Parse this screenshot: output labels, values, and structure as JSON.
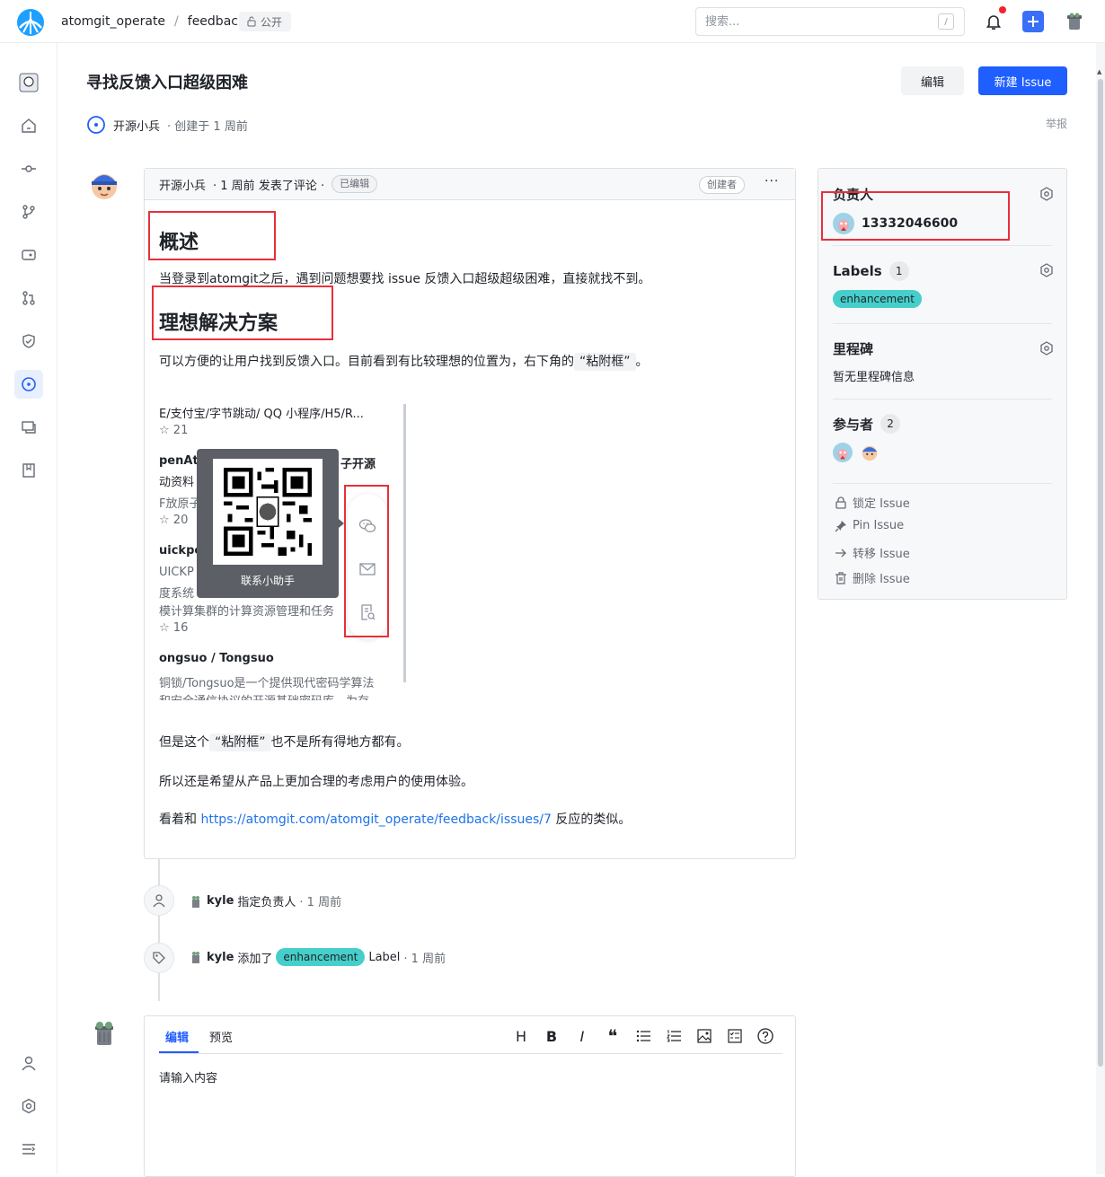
{
  "topbar": {
    "repo_owner": "atomgit_operate",
    "separator": "/",
    "repo_name": "feedback",
    "visibility": "公开",
    "search_placeholder": "搜索...",
    "search_shortcut": "/"
  },
  "issue": {
    "title": "寻找反馈入口超级困难",
    "edit_label": "编辑",
    "new_issue_label": "新建 Issue",
    "author": "开源小兵",
    "created": "· 创建于 1 周前",
    "report_label": "举报"
  },
  "comment": {
    "author": "开源小兵",
    "meta": "· 1 周前 发表了评论 ·",
    "edited": "已编辑",
    "creator": "创建者",
    "more": "···",
    "h_overview": "概述",
    "overview_text": "当登录到atomgit之后，遇到问题想要找 issue 反馈入口超级超级困难，直接就找不到。",
    "h_solution": "理想解决方案",
    "solution_text_pre": "可以方便的让用户找到反馈入口。目前看到有比较理想的位置为，右下角的",
    "solution_code": "“粘附框”",
    "solution_text_post": "。",
    "para2_pre": "但是这个",
    "para2_code": "“粘附框”",
    "para2_post": "也不是所有得地方都有。",
    "para3": "所以还是希望从产品上更加合理的考虑用户的使用体验。",
    "para4_pre": "看着和",
    "para4_link": "https://atomgit.com/atomgit_operate/feedback/issues/7",
    "para4_post": "反应的类似。"
  },
  "embedded_screenshot": {
    "line1": "E/支付宝/字节跳动/ QQ 小程序/H5/R...",
    "line2": "21",
    "line3a": "penAt",
    "line3b": "子开源",
    "line4": "动资料",
    "line5": "F放原子",
    "line6": "20",
    "line7": "uickpo",
    "line8": "UICKP",
    "line9": "度系统",
    "line10": "模计算集群的计算资源管理和任务",
    "line11": "16",
    "line12": "ongsuo / Tongsuo",
    "line13": "铜锁/Tongsuo是一个提供现代密码学算法",
    "line14": "和安全通信协议的开源基础密码库，为存",
    "qr_label": "联系小助手"
  },
  "timeline": [
    {
      "user": "kyle",
      "action": "指定负责人",
      "time": "· 1 周前"
    },
    {
      "user": "kyle",
      "action": "添加了",
      "label": "enhancement",
      "suffix": "Label",
      "time": "· 1 周前"
    }
  ],
  "editor": {
    "tab_edit": "编辑",
    "tab_preview": "预览",
    "placeholder": "请输入内容",
    "tool_heading": "H",
    "tool_bold": "B",
    "tool_italic": "I",
    "tool_quote": "❝"
  },
  "sidebar_panel": {
    "assignee_title": "负责人",
    "assignee_name": "13332046600",
    "labels_title": "Labels",
    "labels_count": "1",
    "label_name": "enhancement",
    "milestone_title": "里程碑",
    "milestone_value": "暂无里程碑信息",
    "participants_title": "参与者",
    "participants_count": "2",
    "lock": "锁定 Issue",
    "pin": "Pin Issue",
    "transfer": "转移 Issue",
    "delete": "删除 Issue"
  },
  "colors": {
    "primary": "#1f5eff",
    "label_bg": "#46cfca",
    "annotation_red": "#e8303b",
    "notification_dot": "#f5222d"
  }
}
